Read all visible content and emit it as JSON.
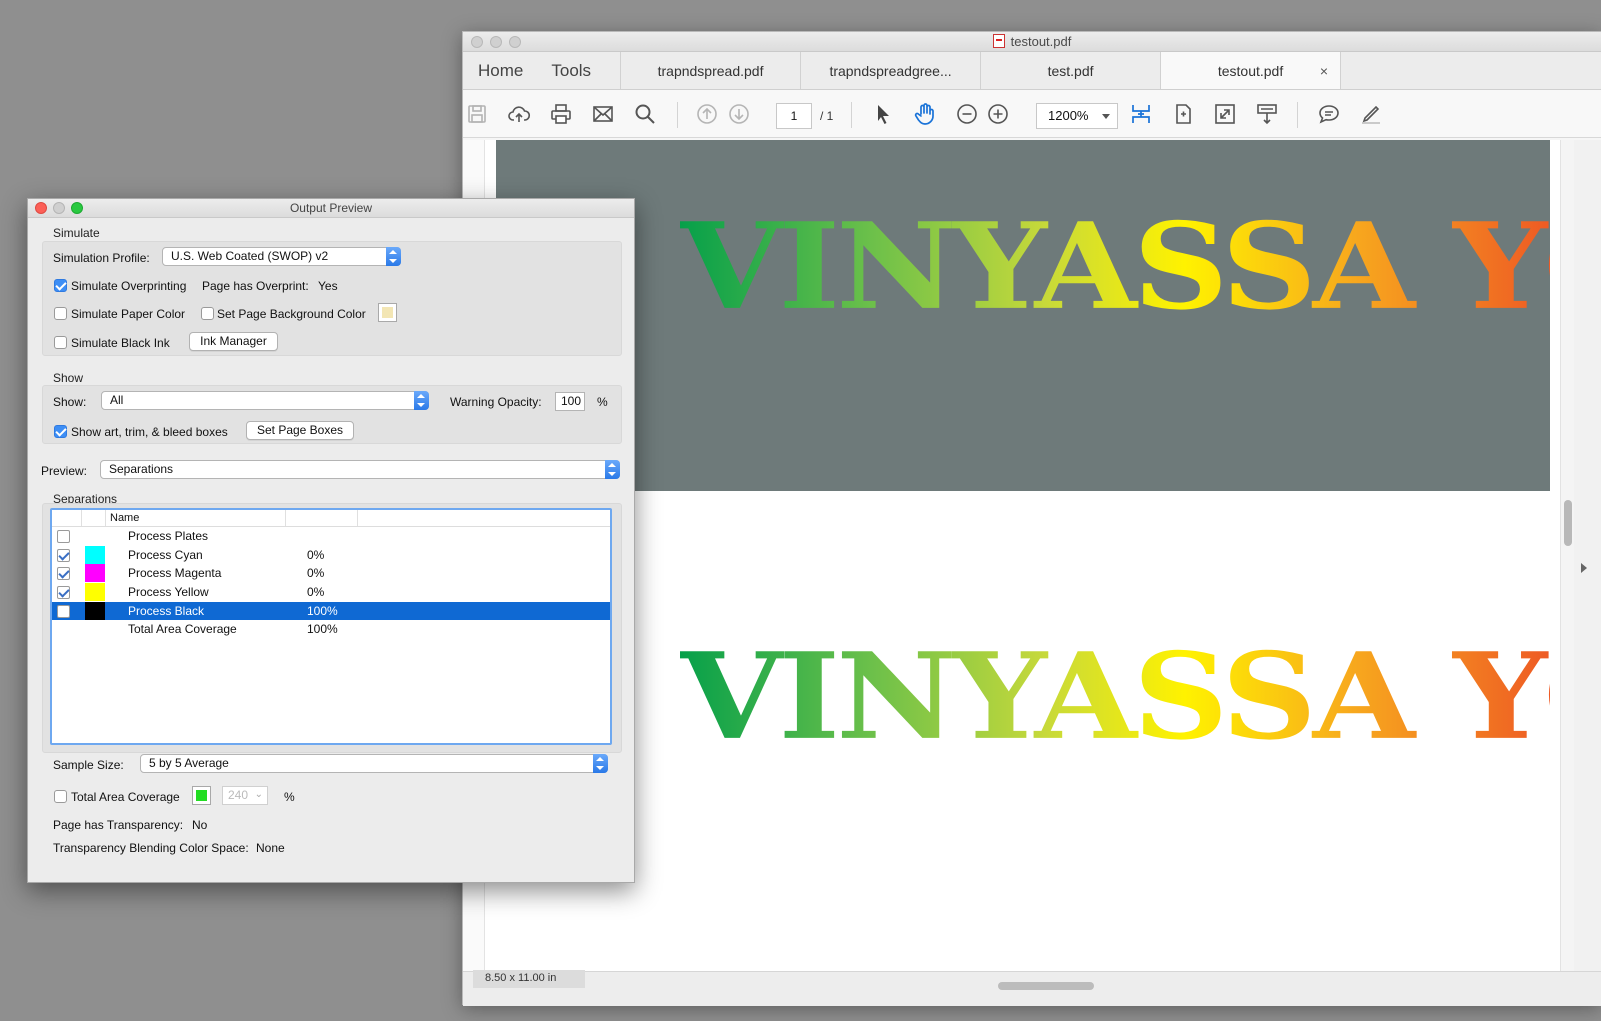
{
  "acrobat": {
    "window_title": "testout.pdf",
    "nav": {
      "home": "Home",
      "tools": "Tools"
    },
    "tabs": [
      {
        "label": "trapndspread.pdf"
      },
      {
        "label": "trapndspreadgree..."
      },
      {
        "label": "test.pdf"
      },
      {
        "label": "testout.pdf",
        "close": "×"
      }
    ],
    "toolbar": {
      "page_current": "1",
      "page_total": "/ 1",
      "zoom": "1200%"
    },
    "document": {
      "art_text": "VINYASSA YOGA",
      "page_size": "8.50 x 11.00 in"
    }
  },
  "output_preview": {
    "title": "Output Preview",
    "simulate": {
      "section_label": "Simulate",
      "profile_label": "Simulation Profile:",
      "profile_value": "U.S. Web Coated (SWOP) v2",
      "overprinting_label": "Simulate Overprinting",
      "overprinting_checked": true,
      "page_overprint_label": "Page has Overprint:",
      "page_overprint_value": "Yes",
      "paper_color_label": "Simulate Paper Color",
      "bg_color_label": "Set Page Background Color",
      "black_ink_label": "Simulate Black Ink",
      "ink_manager_button": "Ink Manager",
      "bg_swatch_color": "#f3e6b4"
    },
    "show": {
      "section_label": "Show",
      "show_label": "Show:",
      "show_value": "All",
      "warning_label": "Warning Opacity:",
      "warning_value": "100",
      "percent": "%",
      "boxes_label": "Show art, trim, & bleed boxes",
      "boxes_checked": true,
      "page_boxes_button": "Set Page Boxes"
    },
    "preview": {
      "label": "Preview:",
      "value": "Separations"
    },
    "separations": {
      "section_label": "Separations",
      "column_name": "Name",
      "rows": [
        {
          "name": "Process Plates",
          "pct": "",
          "checked": false,
          "color": ""
        },
        {
          "name": "Process Cyan",
          "pct": "0%",
          "checked": true,
          "color": "#00ffff"
        },
        {
          "name": "Process Magenta",
          "pct": "0%",
          "checked": true,
          "color": "#ff00ff"
        },
        {
          "name": "Process Yellow",
          "pct": "0%",
          "checked": true,
          "color": "#ffff00"
        },
        {
          "name": "Process Black",
          "pct": "100%",
          "checked": false,
          "color": "#000000",
          "selected": true
        },
        {
          "name": "Total Area Coverage",
          "pct": "100%",
          "checked": null,
          "color": ""
        }
      ]
    },
    "sample": {
      "label": "Sample Size:",
      "value": "5 by 5 Average"
    },
    "tac": {
      "label": "Total Area Coverage",
      "swatch_color": "#22dd22",
      "value": "240",
      "percent": "%"
    },
    "transparency": {
      "label": "Page has Transparency:",
      "value": "No"
    },
    "blending": {
      "label": "Transparency Blending Color Space:",
      "value": "None"
    }
  }
}
